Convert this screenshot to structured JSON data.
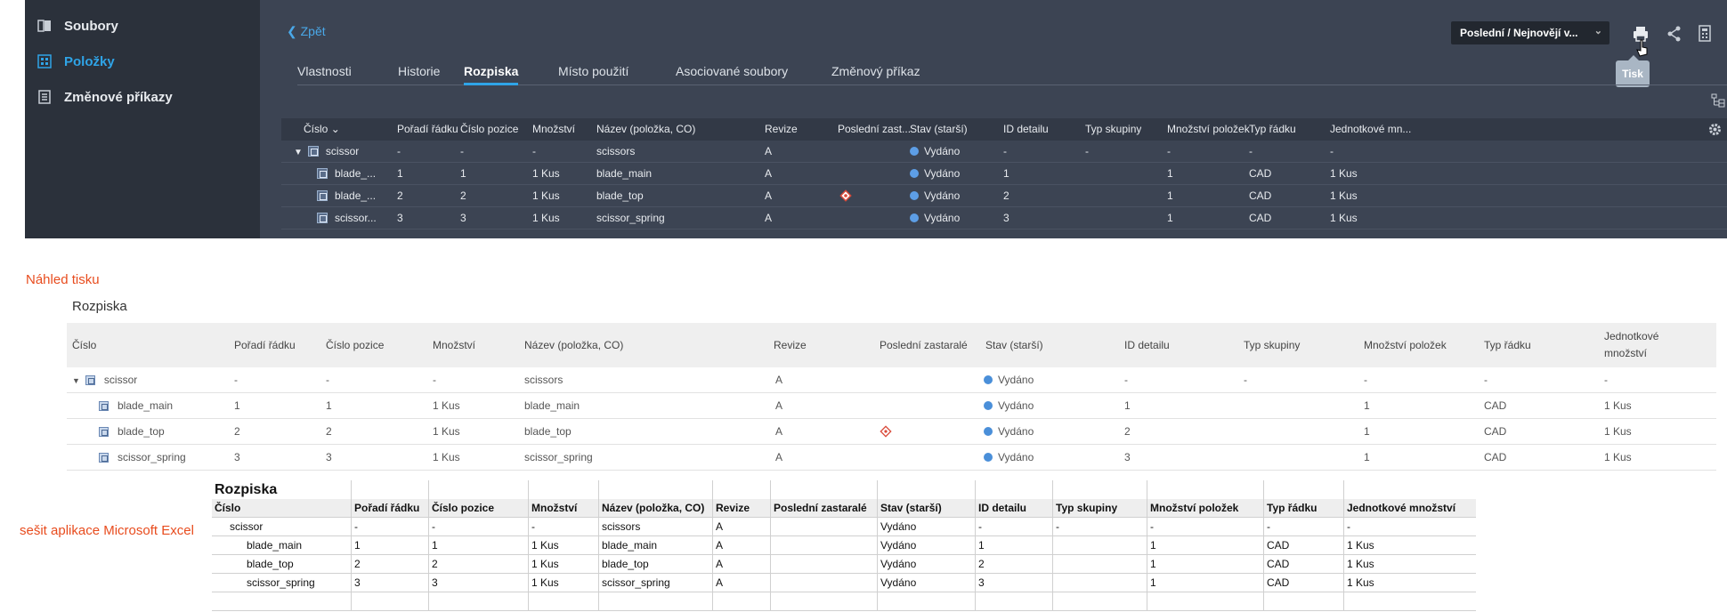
{
  "sidebar": {
    "items": [
      {
        "label": "Soubory",
        "icon": "files-icon"
      },
      {
        "label": "Položky",
        "icon": "items-icon"
      },
      {
        "label": "Změnové příkazy",
        "icon": "change-orders-icon"
      }
    ],
    "active_color": "#2fa4e7"
  },
  "header": {
    "back_label": "Zpět",
    "version_select": "Poslední / Nejnovějí v...",
    "tooltip": "Tisk"
  },
  "tabs": [
    "Vlastnosti",
    "Historie",
    "Rozpiska",
    "Místo použití",
    "Asociované soubory",
    "Změnový příkaz"
  ],
  "active_tab": "Rozpiska",
  "grid": {
    "columns": [
      "Číslo",
      "Pořadí řádku",
      "Číslo pozice",
      "Množství",
      "Název (položka, CO)",
      "Revize",
      "Poslední zast...",
      "Stav (starší)",
      "ID detailu",
      "Typ skupiny",
      "Množství položek",
      "Typ řádku",
      "Jednotkové mn..."
    ],
    "rows": [
      [
        "scissor",
        "-",
        "-",
        "-",
        "scissors",
        "A",
        "",
        "Vydáno",
        "-",
        "-",
        "-",
        "-",
        "-"
      ],
      [
        "blade_...",
        "1",
        "1",
        "1 Kus",
        "blade_main",
        "A",
        "",
        "Vydáno",
        "1",
        "",
        "1",
        "CAD",
        "1 Kus"
      ],
      [
        "blade_...",
        "2",
        "2",
        "1 Kus",
        "blade_top",
        "A",
        "",
        "Vydáno",
        "2",
        "",
        "1",
        "CAD",
        "1 Kus"
      ],
      [
        "scissor...",
        "3",
        "3",
        "1 Kus",
        "scissor_spring",
        "A",
        "",
        "Vydáno",
        "3",
        "",
        "1",
        "CAD",
        "1 Kus"
      ]
    ],
    "status_color": "#5d9ee6"
  },
  "print_preview": {
    "caption": "Náhled tisku",
    "title": "Rozpiska",
    "columns": [
      "Číslo",
      "Pořadí řádku",
      "Číslo pozice",
      "Množství",
      "Název (položka, CO)",
      "Revize",
      "Poslední zastaralé",
      "Stav (starší)",
      "ID detailu",
      "Typ skupiny",
      "Množství položek",
      "Typ řádku",
      "Jednotkové množství"
    ],
    "rows": [
      [
        "scissor",
        "-",
        "-",
        "-",
        "scissors",
        "A",
        "",
        "Vydáno",
        "-",
        "-",
        "-",
        "-",
        "-"
      ],
      [
        "blade_main",
        "1",
        "1",
        "1 Kus",
        "blade_main",
        "A",
        "",
        "Vydáno",
        "1",
        "",
        "1",
        "CAD",
        "1 Kus"
      ],
      [
        "blade_top",
        "2",
        "2",
        "1 Kus",
        "blade_top",
        "A",
        "",
        "Vydáno",
        "2",
        "",
        "1",
        "CAD",
        "1 Kus"
      ],
      [
        "scissor_spring",
        "3",
        "3",
        "1 Kus",
        "scissor_spring",
        "A",
        "",
        "Vydáno",
        "3",
        "",
        "1",
        "CAD",
        "1 Kus"
      ]
    ]
  },
  "excel": {
    "caption": "sešit aplikace Microsoft Excel",
    "title": "Rozpiska",
    "columns": [
      "Číslo",
      "Pořadí řádku",
      "Číslo pozice",
      "Množství",
      "Název (položka, CO)",
      "Revize",
      "Poslední zastaralé",
      "Stav (starší)",
      "ID detailu",
      "Typ skupiny",
      "Množství položek",
      "Typ řádku",
      "Jednotkové množství"
    ],
    "rows": [
      [
        "scissor",
        "-",
        "-",
        "-",
        "scissors",
        "A",
        "",
        "Vydáno",
        "-",
        "-",
        "-",
        "-",
        "-"
      ],
      [
        "blade_main",
        "1",
        "1",
        "1 Kus",
        "blade_main",
        "A",
        "",
        "Vydáno",
        "1",
        "",
        "1",
        "CAD",
        "1 Kus"
      ],
      [
        "blade_top",
        "2",
        "2",
        "1 Kus",
        "blade_top",
        "A",
        "",
        "Vydáno",
        "2",
        "",
        "1",
        "CAD",
        "1 Kus"
      ],
      [
        "scissor_spring",
        "3",
        "3",
        "1 Kus",
        "scissor_spring",
        "A",
        "",
        "Vydáno",
        "3",
        "",
        "1",
        "CAD",
        "1 Kus"
      ]
    ]
  },
  "caption_color": "#e84c1e"
}
